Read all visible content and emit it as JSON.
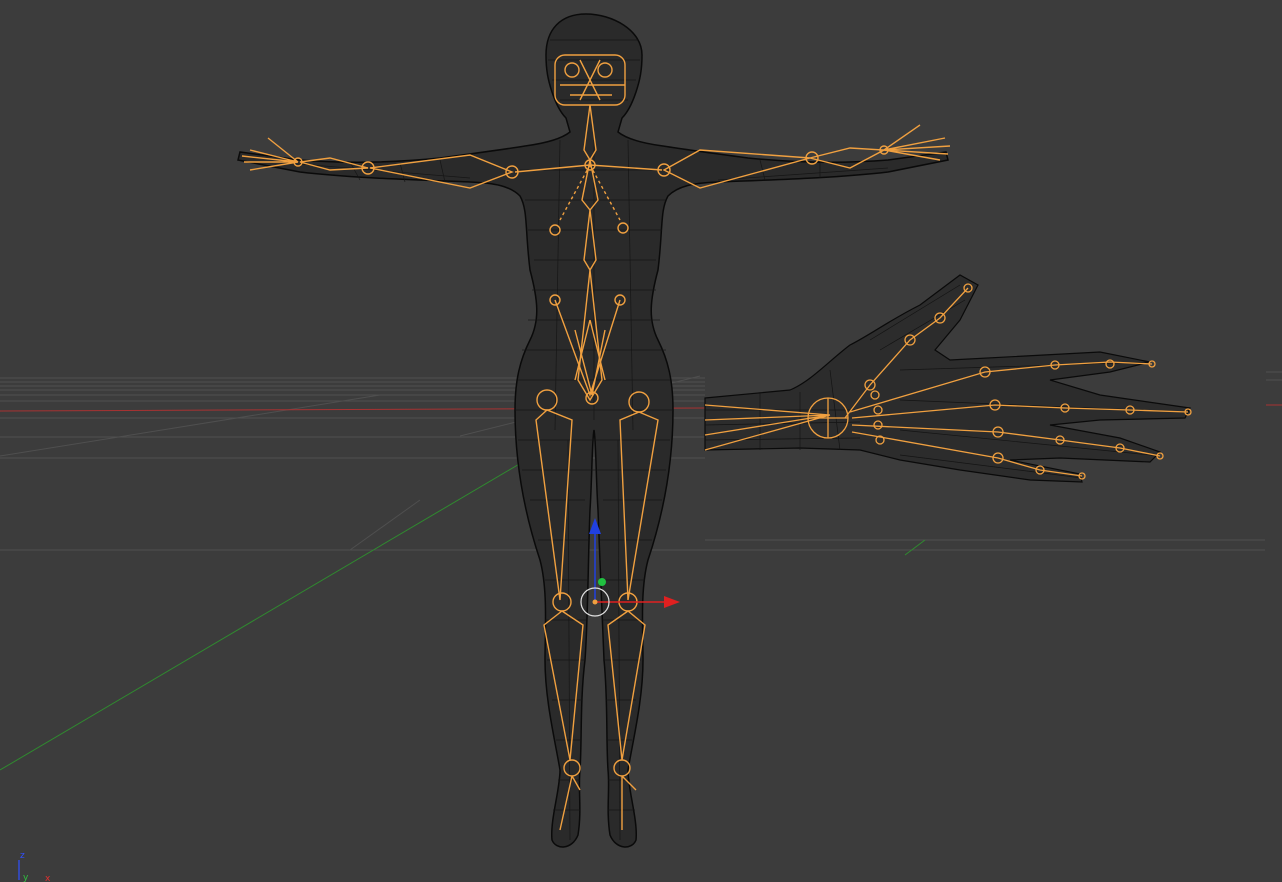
{
  "viewport": {
    "background": "#3c3c3c",
    "grid_color": "#555555",
    "x_axis_color": "#a83232",
    "y_axis_color": "#2f8a2f",
    "mesh_color": "#0a0a0a",
    "armature_color": "#f0a040"
  },
  "gizmo": {
    "x_arrow_color": "#e02020",
    "y_dot_color": "#20c040",
    "z_arrow_color": "#2040e0"
  },
  "orientation_widget": {
    "z_label": "z",
    "y_label": "y",
    "x_label": "x"
  }
}
